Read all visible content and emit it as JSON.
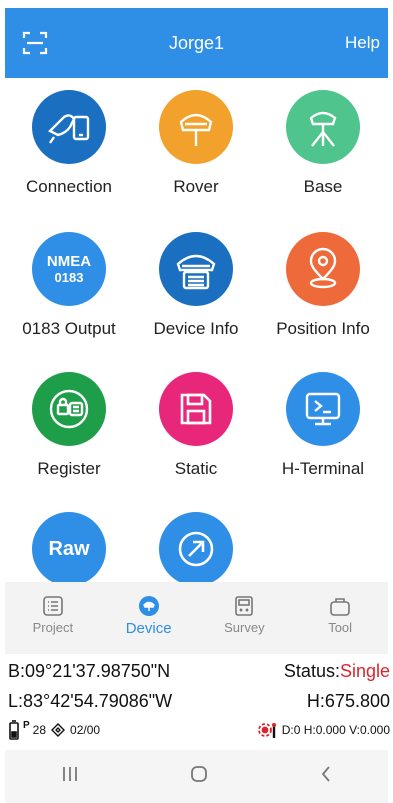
{
  "header": {
    "title": "Jorge1",
    "help_label": "Help",
    "icon": "scan-icon",
    "color": "#2f8ee6"
  },
  "tiles": [
    {
      "label": "Connection",
      "icon": "connection-icon",
      "color": "#1a6fc1"
    },
    {
      "label": "Rover",
      "icon": "rover-receiver-icon",
      "color": "#f2a12c"
    },
    {
      "label": "Base",
      "icon": "base-tripod-icon",
      "color": "#4fc48c"
    },
    {
      "label": "0183 Output",
      "icon": "nmea-icon",
      "icon_text": "NMEA",
      "icon_subtext": "0183",
      "color": "#2f8ee6"
    },
    {
      "label": "Device Info",
      "icon": "device-info-icon",
      "color": "#1a6fc1"
    },
    {
      "label": "Position Info",
      "icon": "location-pin-icon",
      "color": "#ef6a3a"
    },
    {
      "label": "Register",
      "icon": "register-icon",
      "color": "#1f9e4a"
    },
    {
      "label": "Static",
      "icon": "save-disk-icon",
      "color": "#e8267a"
    },
    {
      "label": "H-Terminal",
      "icon": "terminal-icon",
      "color": "#2f8ee6"
    },
    {
      "label": "",
      "icon": "raw-icon",
      "icon_text": "Raw",
      "color": "#2f8ee6"
    },
    {
      "label": "",
      "icon": "arrow-circle-icon",
      "color": "#2f8ee6"
    }
  ],
  "bottom_nav": {
    "items": [
      {
        "label": "Project",
        "icon": "project-list-icon",
        "active": false
      },
      {
        "label": "Device",
        "icon": "device-icon",
        "active": true
      },
      {
        "label": "Survey",
        "icon": "survey-icon",
        "active": false
      },
      {
        "label": "Tool",
        "icon": "tool-bag-icon",
        "active": false
      }
    ]
  },
  "status": {
    "b": "B:09°21'37.98750\"N",
    "status_label": "Status:",
    "status_value": "Single",
    "l": "L:83°42'54.79086\"W",
    "h": "H:675.800",
    "sat_prefix": "P",
    "sat_count": "28",
    "link": "02/00",
    "precision": "D:0 H:0.000 V:0.000"
  },
  "colors": {
    "accent": "#2f8ee6",
    "status_value": "#d9262c"
  },
  "system_nav": {
    "icons": [
      "recent-apps-icon",
      "home-icon",
      "back-icon"
    ]
  }
}
